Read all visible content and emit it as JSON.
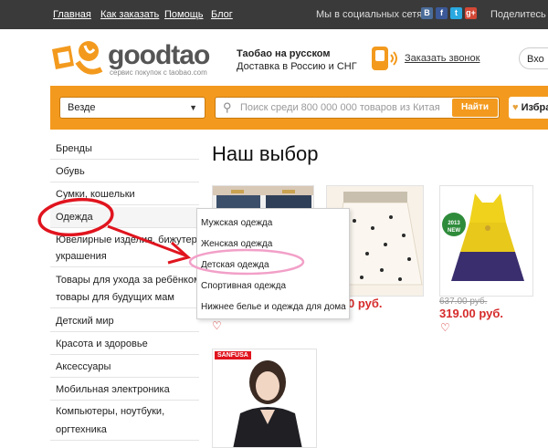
{
  "topnav": {
    "items": [
      "Главная",
      "Как заказать",
      "Помощь",
      "Блог"
    ]
  },
  "social": {
    "label": "Мы в социальных сетях:",
    "icons": [
      "vk-icon",
      "facebook-icon",
      "twitter-icon",
      "google-plus-icon"
    ],
    "share": "Поделитесь с"
  },
  "logo": {
    "name": "goodtao",
    "tagline": "сервис покупок с taobao.com"
  },
  "header": {
    "line1": "Таобао на русском",
    "line2": "Доставка в Россию и СНГ",
    "callback": "Заказать звонок",
    "login": "Вхо"
  },
  "search": {
    "scope": "Везде",
    "placeholder": "Поиск среди 800 000 000 товаров из Китая",
    "button": "Найти"
  },
  "favorites": {
    "label": "Избра"
  },
  "sidebar": {
    "categories": [
      "Бренды",
      "Обувь",
      "Сумки, кошельки",
      "Одежда",
      "Ювелирные изделия, бижутерия,",
      "украшения",
      "Товары для ухода за ребёнком,",
      "товары для будущих мам",
      "Детский мир",
      "Красота и здоровье",
      "Аксессуары",
      "Мобильная электроника",
      "Компьютеры, ноутбуки,",
      "оргтехника"
    ]
  },
  "submenu": {
    "items": [
      "Мужская одежда",
      "Женская одежда",
      "Детская одежда",
      "Спортивная одежда",
      "Нижнее белье и одежда для дома"
    ]
  },
  "main": {
    "title": "Наш выбор"
  },
  "products": [
    {
      "price_partial": "0 руб."
    },
    {
      "old_price": "637.00 руб.",
      "price": "319.00 руб.",
      "tag_year": "2013",
      "tag_new": "NEW"
    },
    {
      "brand": "SANFUSA"
    }
  ],
  "colors": {
    "accent": "#f39a1e",
    "topbar": "#3a3a3a",
    "annotation": "#e0141e",
    "highlight": "#f2a0c8"
  }
}
